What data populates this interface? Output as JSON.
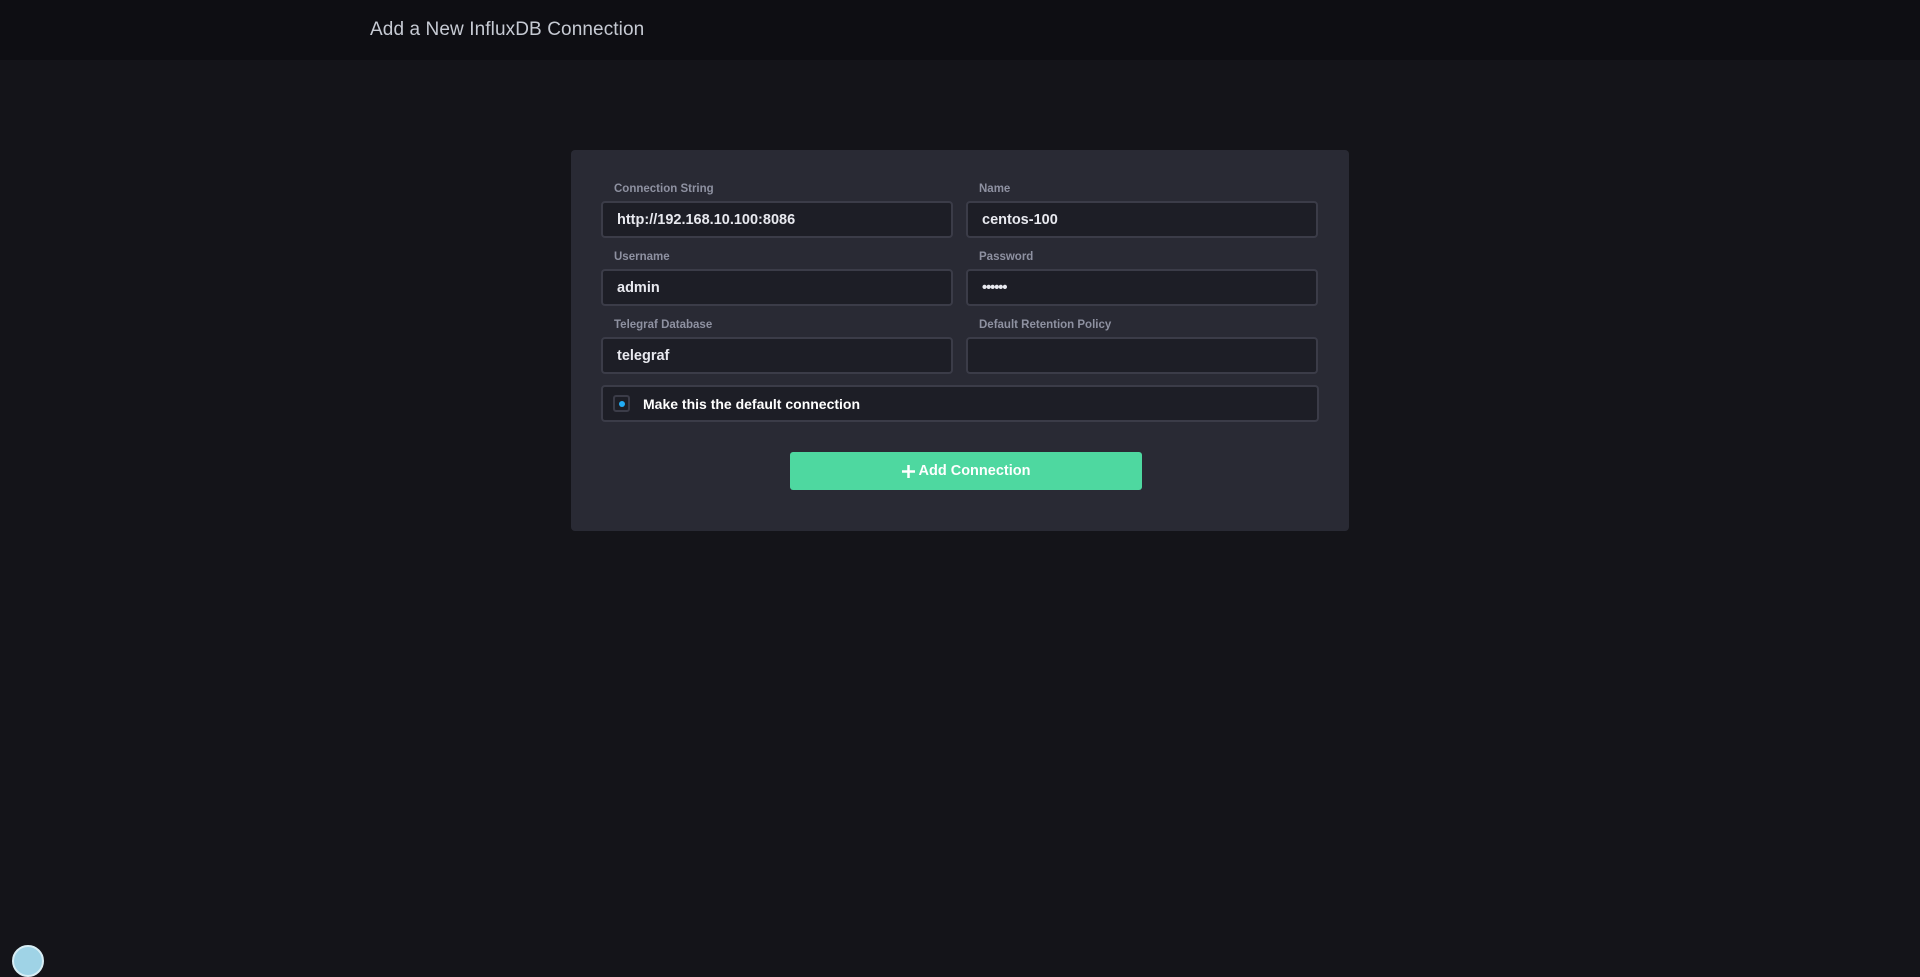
{
  "header": {
    "title": "Add a New InfluxDB Connection"
  },
  "form": {
    "connection_string": {
      "label": "Connection String",
      "value": "http://192.168.10.100:8086"
    },
    "name": {
      "label": "Name",
      "value": "centos-100"
    },
    "username": {
      "label": "Username",
      "value": "admin"
    },
    "password": {
      "label": "Password",
      "value": "••••••"
    },
    "telegraf_database": {
      "label": "Telegraf Database",
      "value": "telegraf"
    },
    "default_retention_policy": {
      "label": "Default Retention Policy",
      "value": ""
    },
    "default_connection": {
      "label": "Make this the default connection",
      "checked": true
    },
    "submit": {
      "label": "Add Connection",
      "icon": "plus-icon"
    }
  },
  "colors": {
    "background": "#141419",
    "topbar": "#0e0e13",
    "panel": "#292a34",
    "input_bg": "#1d1e26",
    "input_border": "#3b3c48",
    "accent_green": "#4ed8a0",
    "checkbox_dot": "#22adf6"
  }
}
